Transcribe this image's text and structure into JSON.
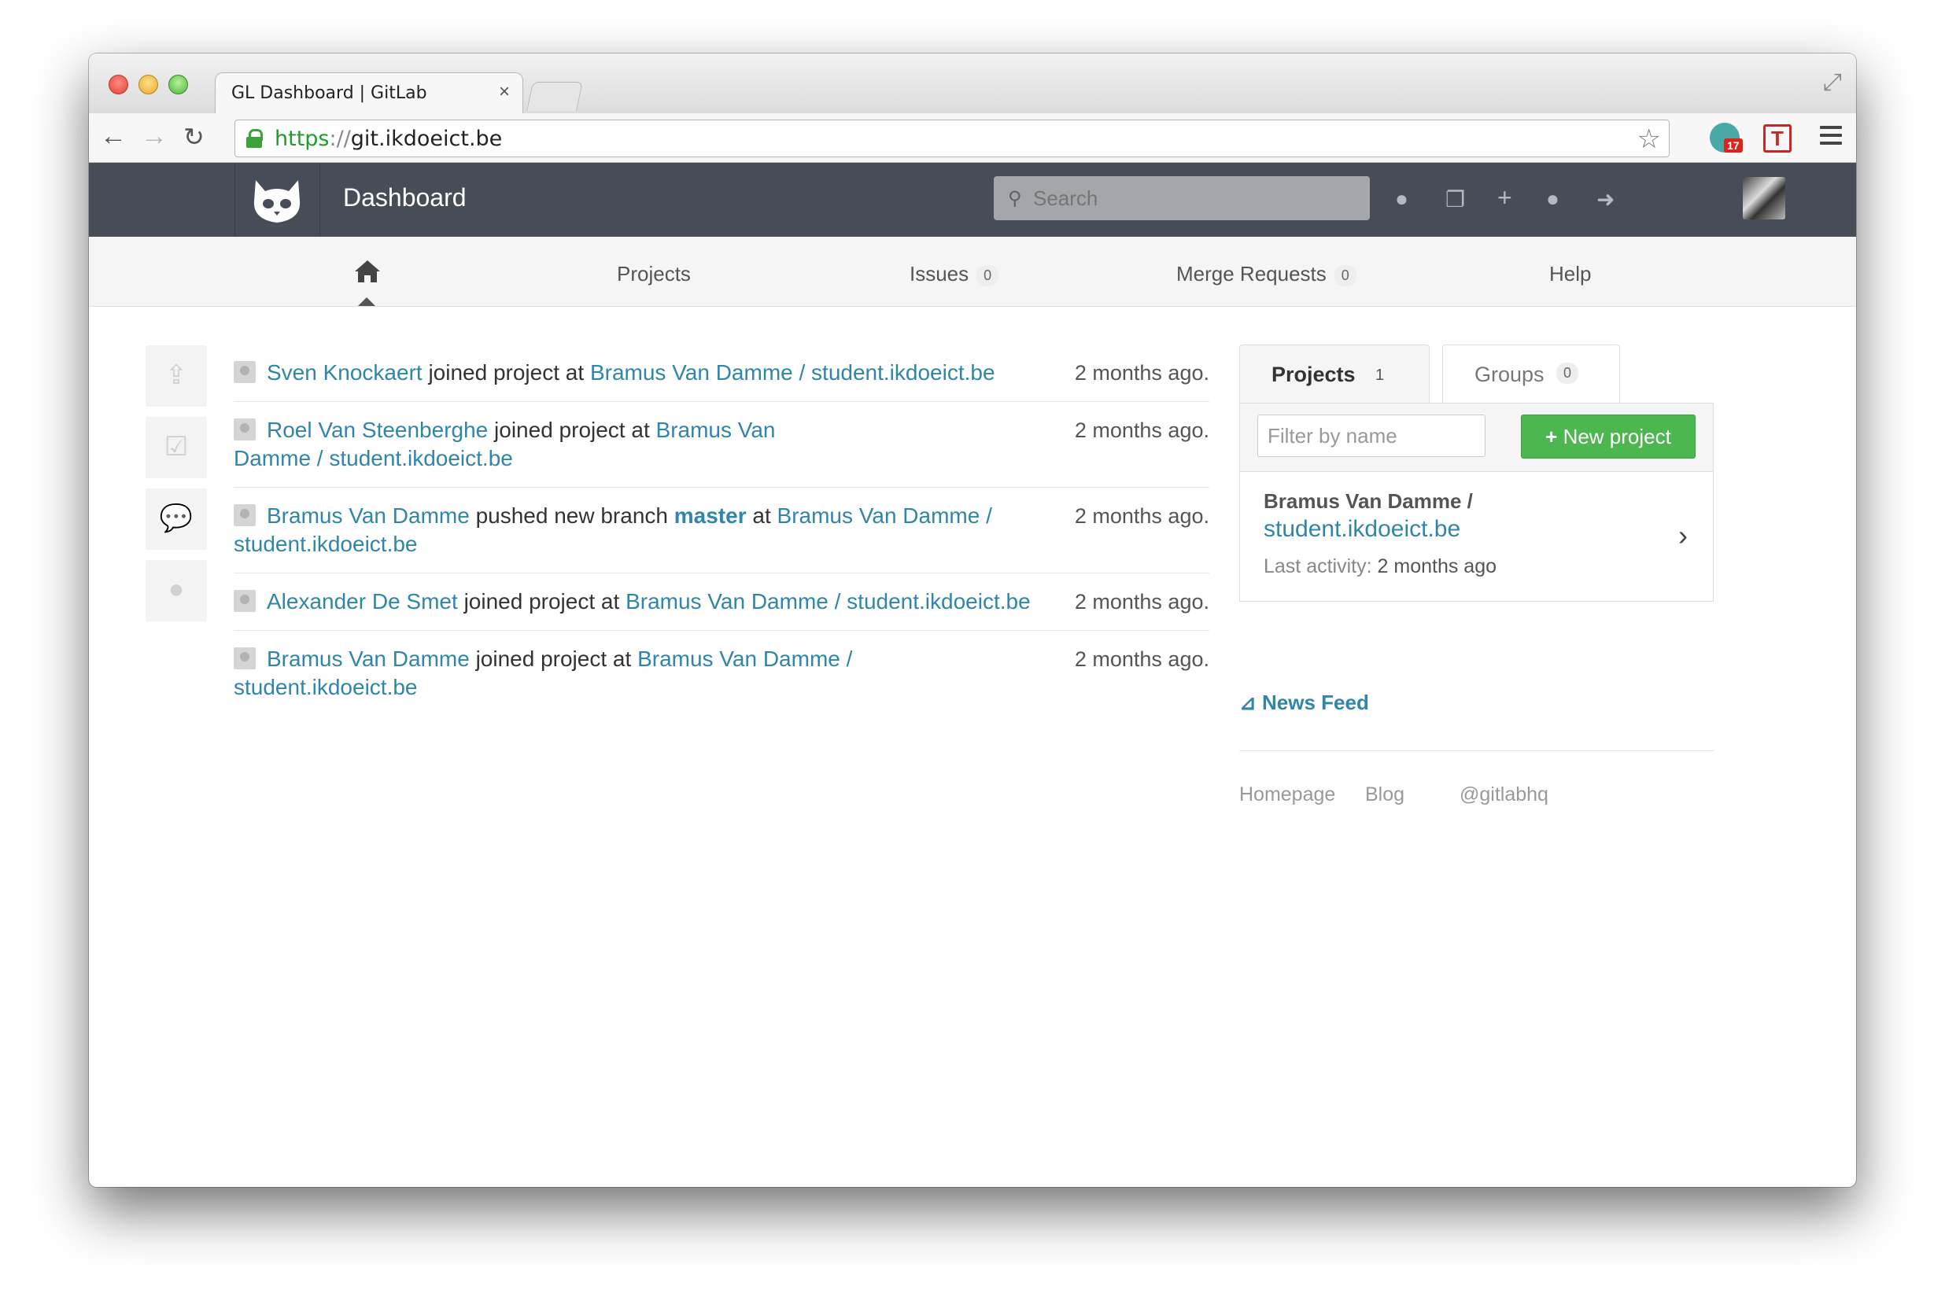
{
  "browser": {
    "tab_title": "GL Dashboard | GitLab",
    "tab_close": "×",
    "url_scheme": "https",
    "url_sep": "://",
    "url_host": "git.ikdoeict.be",
    "extension_badge": "17",
    "extension_t": "T"
  },
  "header": {
    "title": "Dashboard",
    "search_placeholder": "Search"
  },
  "subnav": {
    "projects": "Projects",
    "issues": "Issues",
    "issues_count": "0",
    "merge_requests": "Merge Requests",
    "merge_requests_count": "0",
    "help": "Help"
  },
  "events": [
    {
      "user": "Sven Knockaert",
      "action": "joined project",
      "at": "at",
      "project": "Bramus Van Damme / student.ikdoeict.be",
      "time": "2 months ago."
    },
    {
      "user": "Roel Van Steenberghe",
      "action": "joined project",
      "at": "at",
      "project": "Bramus Van Damme / student.ikdoeict.be",
      "time": "2 months ago."
    },
    {
      "user": "Bramus Van Damme",
      "action": "pushed new branch",
      "branch": "master",
      "at": "at",
      "project": "Bramus Van Damme / student.ikdoeict.be",
      "time": "2 months ago."
    },
    {
      "user": "Alexander De Smet",
      "action": "joined project",
      "at": "at",
      "project": "Bramus Van Damme / student.ikdoeict.be",
      "time": "2 months ago."
    },
    {
      "user": "Bramus Van Damme",
      "action": "joined project",
      "at": "at",
      "project": "Bramus Van Damme / student.ikdoeict.be",
      "time": "2 months ago."
    }
  ],
  "sidebar": {
    "projects_tab": "Projects",
    "projects_count": "1",
    "groups_tab": "Groups",
    "groups_count": "0",
    "filter_placeholder": "Filter by name",
    "new_project": "New project",
    "project": {
      "namespace": "Bramus Van Damme /",
      "name": "student.ikdoeict.be",
      "activity_label": "Last activity:",
      "activity_value": "2 months ago"
    },
    "news_feed": "News Feed"
  },
  "footer": {
    "homepage": "Homepage",
    "blog": "Blog",
    "twitter": "@gitlabhq"
  },
  "colors": {
    "header_bg": "#474d57",
    "link": "#2f86a8",
    "new_button": "#4cb74f"
  }
}
